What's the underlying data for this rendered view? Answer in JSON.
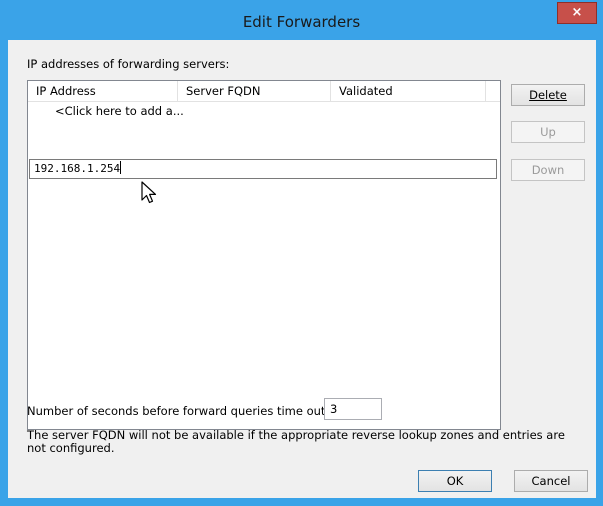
{
  "window": {
    "title": "Edit Forwarders",
    "close_glyph": "×"
  },
  "forwarders": {
    "label": "IP addresses of forwarding servers:",
    "columns": [
      "IP Address",
      "Server FQDN",
      "Validated"
    ],
    "add_placeholder": "<Click here to add a...",
    "editing_value": "192.168.1.254"
  },
  "side_buttons": {
    "delete": "Delete",
    "up": "Up",
    "down": "Down"
  },
  "timeout": {
    "label": "Number of seconds before forward queries time out:",
    "value": "3"
  },
  "note": "The server FQDN will not be available if the appropriate reverse lookup zones and entries are not configured.",
  "footer": {
    "ok": "OK",
    "cancel": "Cancel"
  },
  "colors": {
    "titlebar": "#3aa3e8",
    "close": "#c7504a",
    "client": "#f0f0f0"
  }
}
